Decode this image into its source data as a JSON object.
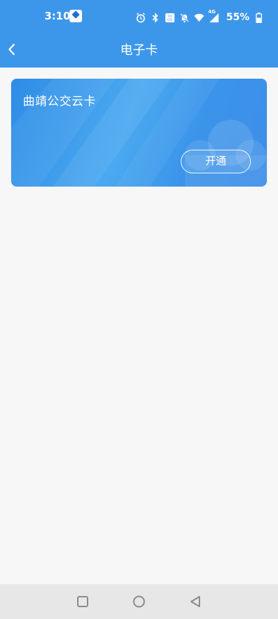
{
  "status_bar": {
    "time": "3:10",
    "battery_percent": "55%",
    "network_label": "4G",
    "icons": [
      "app-notification-icon",
      "alarm-icon",
      "bluetooth-icon",
      "volte-icon",
      "mute-icon",
      "wifi-icon",
      "signal-icon",
      "battery-icon"
    ]
  },
  "header": {
    "title": "电子卡",
    "back_icon": "chevron-left-icon"
  },
  "card": {
    "title": "曲靖公交云卡",
    "button_label": "开通"
  },
  "colors": {
    "primary": "#3c97ea",
    "card_gradient_start": "#2f8ce6",
    "card_gradient_end": "#3d8ee8",
    "background": "#f7f7f7",
    "system_nav": "#e7e7e7"
  },
  "system_nav": {
    "icons": [
      "recents-square-icon",
      "home-circle-icon",
      "back-triangle-icon"
    ]
  }
}
